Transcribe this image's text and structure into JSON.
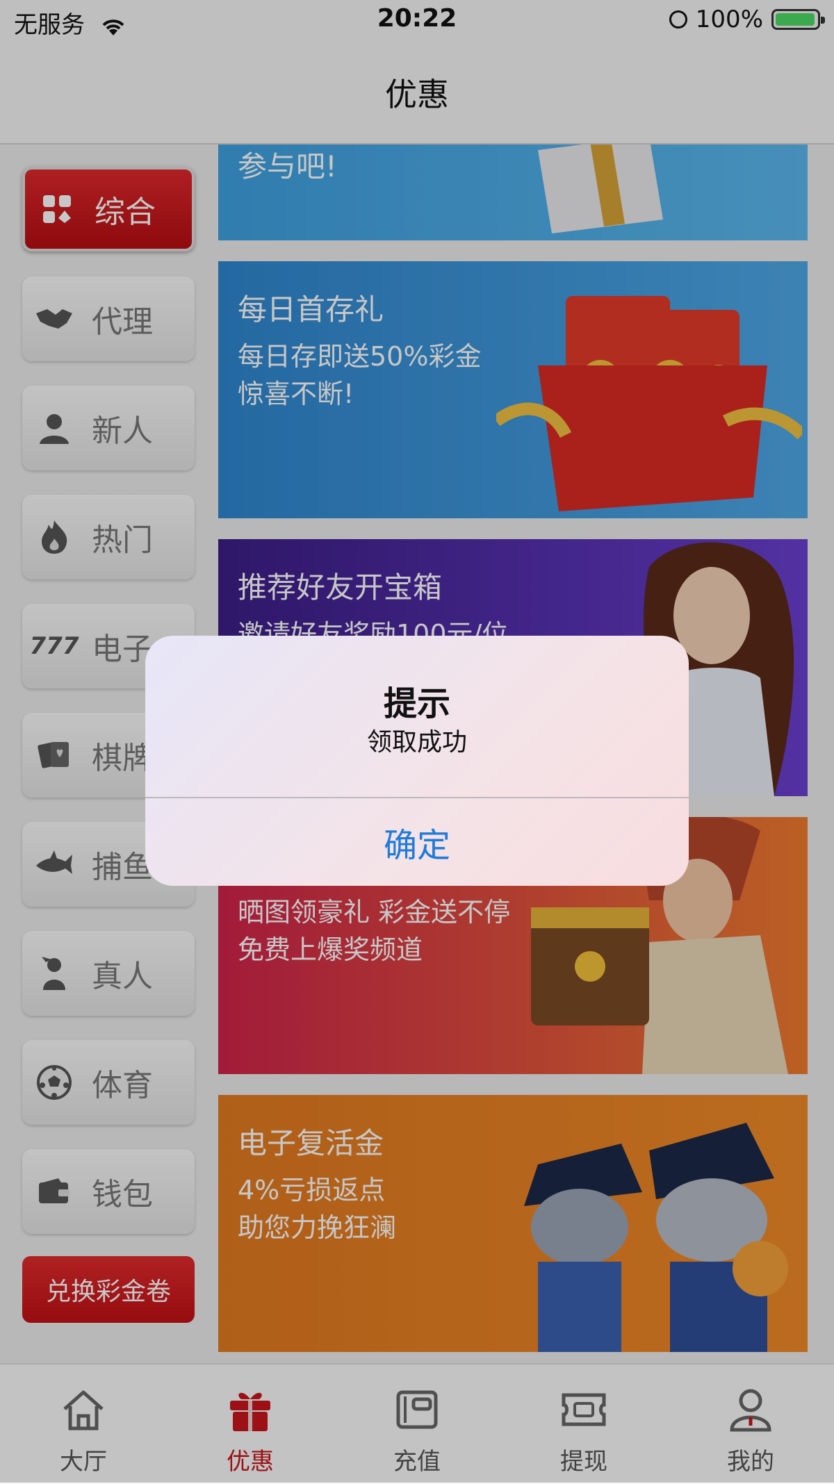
{
  "status_bar": {
    "carrier": "无服务",
    "time": "20:22",
    "battery": "100%"
  },
  "header": {
    "title": "优惠"
  },
  "sidebar": {
    "items": [
      {
        "label": "综合",
        "icon": "grid-card-icon",
        "active": true
      },
      {
        "label": "代理",
        "icon": "handshake-icon"
      },
      {
        "label": "新人",
        "icon": "person-icon"
      },
      {
        "label": "热门",
        "icon": "fire-icon"
      },
      {
        "label": "电子",
        "icon": "slot-777-icon"
      },
      {
        "label": "棋牌",
        "icon": "playing-cards-icon"
      },
      {
        "label": "捕鱼",
        "icon": "shark-icon"
      },
      {
        "label": "真人",
        "icon": "dealer-icon"
      },
      {
        "label": "体育",
        "icon": "soccer-ball-icon"
      },
      {
        "label": "钱包",
        "icon": "wallet-icon"
      }
    ],
    "redeem_label": "兑换彩金卷"
  },
  "banners": [
    {
      "title": "参与吧!",
      "subtitle": ""
    },
    {
      "title": "每日首存礼",
      "subtitle": "每日存即送50%彩金\n惊喜不断!"
    },
    {
      "title": "推荐好友开宝箱",
      "subtitle": "邀请好友奖励100元/位"
    },
    {
      "title": "",
      "subtitle": "晒图领豪礼 彩金送不停\n免费上爆奖频道"
    },
    {
      "title": "电子复活金",
      "subtitle": "4%亏损返点\n助您力挽狂澜"
    }
  ],
  "tabbar": {
    "items": [
      {
        "label": "大厅",
        "icon": "home-icon"
      },
      {
        "label": "优惠",
        "icon": "gift-icon",
        "active": true
      },
      {
        "label": "充值",
        "icon": "wallet-deposit-icon"
      },
      {
        "label": "提现",
        "icon": "ticket-withdraw-icon"
      },
      {
        "label": "我的",
        "icon": "profile-icon"
      }
    ]
  },
  "dialog": {
    "title": "提示",
    "message": "领取成功",
    "confirm_label": "确定"
  },
  "colors": {
    "accent_red": "#c7161b",
    "link_blue": "#1f7bd9"
  }
}
